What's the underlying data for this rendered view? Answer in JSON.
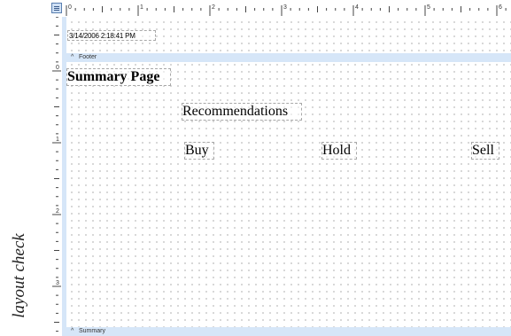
{
  "rulers": {
    "horizontal_numbers": [
      "0",
      "1",
      "2",
      "3",
      "4",
      "5",
      "6"
    ],
    "vertical_numbers": [
      "0",
      "1",
      "2",
      "3"
    ]
  },
  "page_header": {
    "date_value": "3/14/2006 2:18:41 PM"
  },
  "bands": {
    "footer_label": "Footer",
    "summary_label": "Summary"
  },
  "summary_section": {
    "title": "Summary Page",
    "recommendations_label": "Recommendations",
    "columns": [
      "Buy",
      "Hold",
      "Sell"
    ]
  },
  "side_caption": "layout check",
  "colors": {
    "ruler_band": "#d6e6f8",
    "ruler_border": "#a9bcd3",
    "grid_dot": "#b5b5b5",
    "field_border": "#a8a8a8"
  },
  "icons": {
    "corner_button": "report-layout-icon",
    "band_toggle": "caret-up-icon"
  }
}
